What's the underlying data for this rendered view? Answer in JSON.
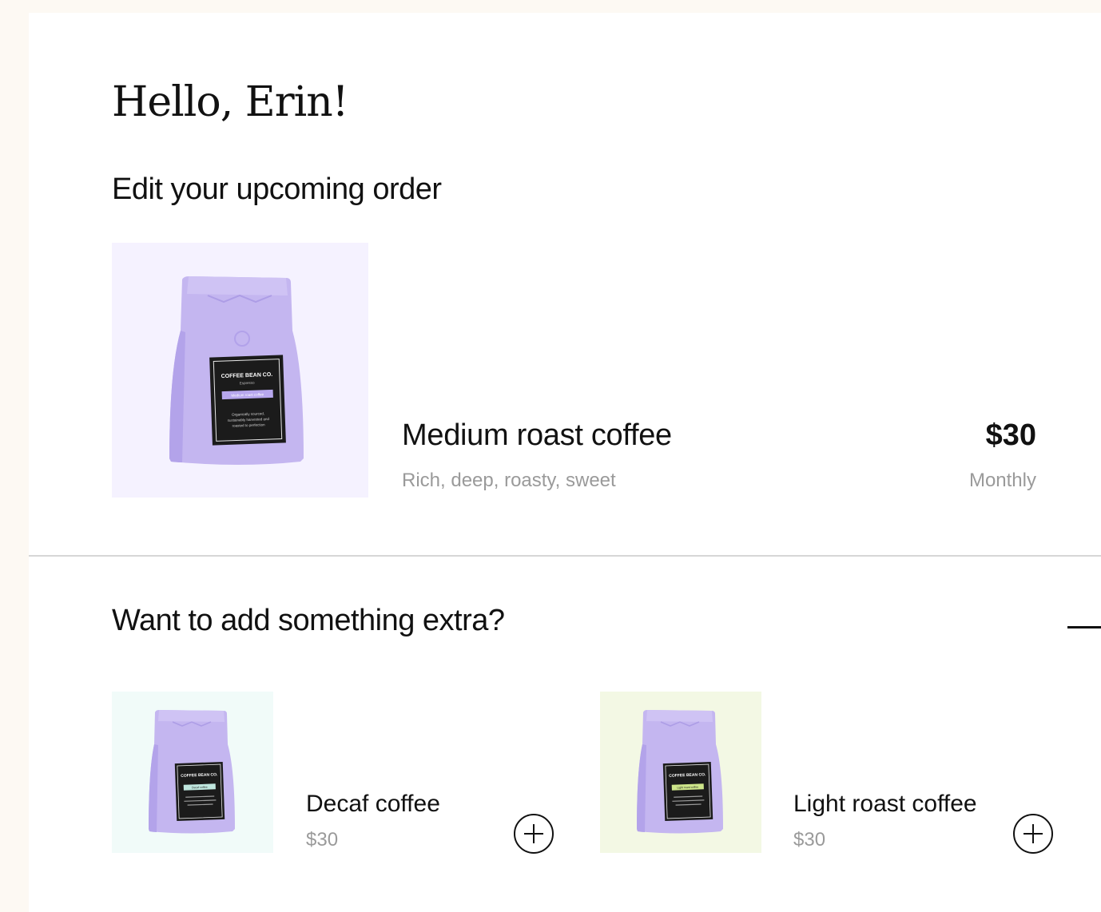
{
  "greeting": "Hello, Erin!",
  "order_section": {
    "title": "Edit your upcoming order",
    "item": {
      "name": "Medium roast coffee",
      "description": "Rich, deep, roasty, sweet",
      "price": "$30",
      "frequency": "Monthly",
      "image_bg": "#f5f2ff",
      "label_band": "#b7a7ee",
      "bag_label": {
        "brand": "COFFEE BEAN CO.",
        "sub": "Espresso",
        "band": "Medium roast coffee",
        "lines": [
          "Organically sourced,",
          "sustainably harvested and",
          "roasted to perfection"
        ]
      }
    }
  },
  "extras_section": {
    "title": "Want to add something extra?",
    "items": [
      {
        "name": "Decaf coffee",
        "price": "$30",
        "image_bg": "#f1fbf9",
        "label_band": "#bfe6de",
        "bag_label": {
          "brand": "COFFEE BEAN CO.",
          "band": "Decaf coffee"
        }
      },
      {
        "name": "Light roast coffee",
        "price": "$30",
        "image_bg": "#f3f8e4",
        "label_band": "#cde58a",
        "bag_label": {
          "brand": "COFFEE BEAN CO.",
          "band": "Light roast coffee"
        }
      }
    ]
  },
  "colors": {
    "page_bg": "#fdf9f3",
    "bag": "#c4b6f0",
    "bag_shadow": "#a896e0",
    "label_bg": "#1b1b1b",
    "muted_text": "#9a9a9a"
  },
  "icons": {
    "add": "plus-circle-icon",
    "collapse": "minus-icon"
  }
}
